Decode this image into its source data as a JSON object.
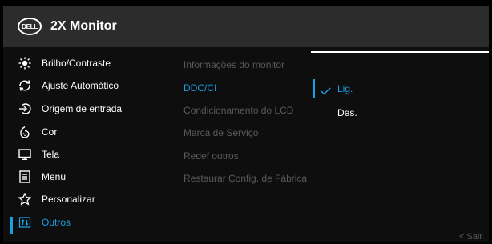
{
  "header": {
    "logo_text": "DELL",
    "title": "2X Monitor"
  },
  "left_menu": [
    {
      "label": "Brilho/Contraste",
      "icon": "brightness-icon"
    },
    {
      "label": "Ajuste Automático",
      "icon": "auto-adjust-icon"
    },
    {
      "label": "Origem de entrada",
      "icon": "input-source-icon"
    },
    {
      "label": "Cor",
      "icon": "color-icon"
    },
    {
      "label": "Tela",
      "icon": "display-icon"
    },
    {
      "label": "Menu",
      "icon": "menu-icon"
    },
    {
      "label": "Personalizar",
      "icon": "star-icon"
    },
    {
      "label": "Outros",
      "icon": "others-icon",
      "selected": true
    }
  ],
  "submenu": [
    {
      "label": "Informações do monitor"
    },
    {
      "label": "DDC/CI",
      "selected": true
    },
    {
      "label": "Condicionamento do LCD"
    },
    {
      "label": "Marca de Serviço"
    },
    {
      "label": "Redef outros"
    },
    {
      "label": "Restaurar Config. de Fábrica"
    }
  ],
  "options": [
    {
      "label": "Lig.",
      "selected": true
    },
    {
      "label": "Des.",
      "selected": false
    }
  ],
  "exit_label": "< Sair",
  "colors": {
    "accent": "#1a9fe0",
    "header_bg": "#2c2c2c",
    "panel_bg": "#0e0e0e",
    "dim_text": "#5a5a5a"
  }
}
